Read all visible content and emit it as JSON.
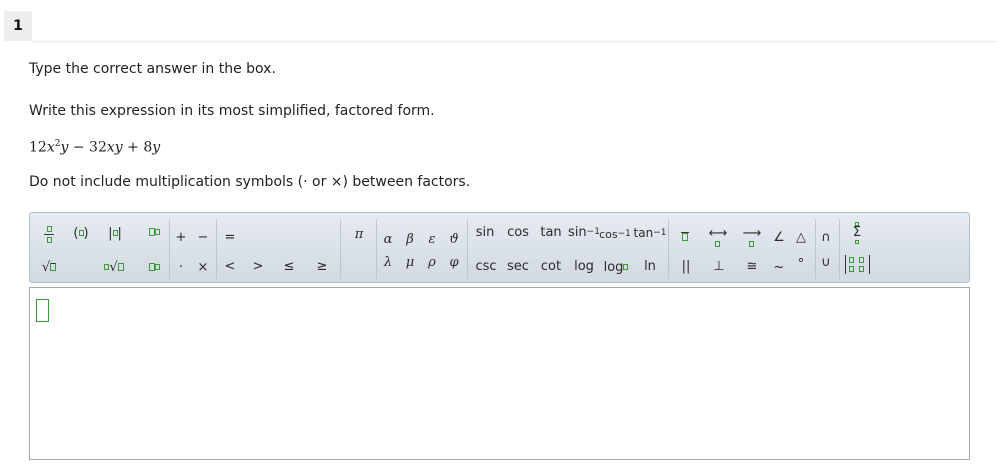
{
  "question": {
    "number": "1",
    "instruction": "Type the correct answer in the box.",
    "prompt": "Write this expression in its most simplified, factored form.",
    "expression": {
      "c1": "12",
      "v1": "x",
      "p1": "2",
      "v2": "y",
      "op1": " − ",
      "c2": "32",
      "v3": "xy",
      "op2": " + ",
      "c3": "8",
      "v4": "y"
    },
    "note": "Do not include multiplication symbols (· or ×) between factors."
  },
  "toolbar": {
    "plus": "+",
    "minus": "−",
    "equals": "=",
    "dot": "·",
    "times": "×",
    "lt": "<",
    "gt": ">",
    "le": "≤",
    "ge": "≥",
    "pi": "π",
    "alpha": "α",
    "beta": "β",
    "epsilon": "ε",
    "theta": "ϑ",
    "lambda": "λ",
    "mu": "μ",
    "rho": "ρ",
    "phi": "φ",
    "sin": "sin",
    "cos": "cos",
    "tan": "tan",
    "asin": "sin",
    "acos": "cos",
    "atan": "tan",
    "inv_exp": "−1",
    "csc": "csc",
    "sec": "sec",
    "cot": "cot",
    "log": "log",
    "logb": "log",
    "ln": "ln",
    "parallel": "||",
    "perp": "⊥",
    "congruent": "≅",
    "similar": "~",
    "degree": "°",
    "angle": "∠",
    "triangle": "△",
    "intersect": "∩",
    "union": "∪",
    "sum": "Σ",
    "paren": "( )",
    "abs": "| |",
    "sqrt": "√",
    "nthroot": "√",
    "line_arrow": "⟷",
    "ray_arrow": "⟶"
  },
  "answer_box": {
    "value": ""
  }
}
